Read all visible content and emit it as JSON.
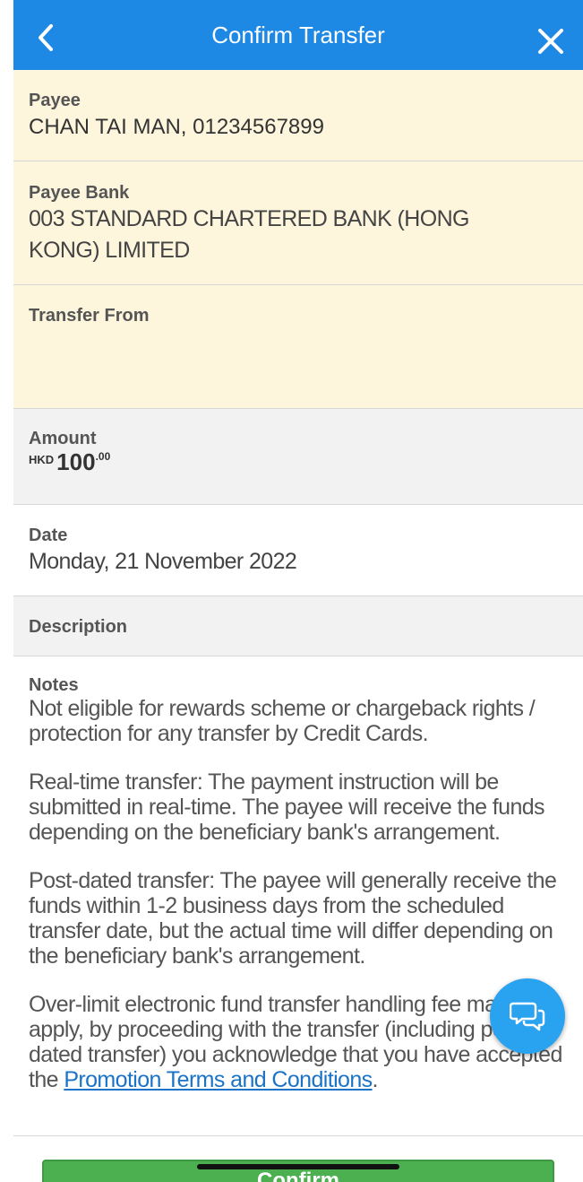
{
  "header": {
    "title": "Confirm Transfer"
  },
  "payee": {
    "label": "Payee",
    "value": "CHAN TAI MAN, 01234567899"
  },
  "payee_bank": {
    "label": "Payee Bank",
    "value": "003 STANDARD CHARTERED BANK (HONG KONG) LIMITED"
  },
  "transfer_from": {
    "label": "Transfer From"
  },
  "amount": {
    "label": "Amount",
    "currency": "HKD",
    "integer": "100",
    "decimal": ".00"
  },
  "date": {
    "label": "Date",
    "value": "Monday, 21 November 2022"
  },
  "description": {
    "label": "Description"
  },
  "notes": {
    "label": "Notes",
    "para1": "Not eligible for rewards scheme or chargeback rights / protection for any transfer by Credit Cards.",
    "para2": "Real-time transfer: The payment instruction will be submitted in real-time. The payee will receive the funds depending on the beneficiary bank's arrangement.",
    "para3": "Post-dated transfer: The payee will generally receive the funds within 1-2 business days from the scheduled transfer date, but the actual time will differ depending on the beneficiary bank's arrangement.",
    "para4_prefix": "Over-limit electronic fund transfer handling fee may apply, by proceeding with the transfer (including post-dated transfer) you acknowledge that you have accepted the ",
    "para4_link": "Promotion Terms and Conditions",
    "para4_suffix": "."
  },
  "footer": {
    "confirm_label": "Confirm"
  },
  "icons": {
    "back": "chevron-left-icon",
    "close": "close-icon",
    "chat": "chat-bubbles-icon"
  },
  "colors": {
    "header": "#1e88e5",
    "cream": "#fdf5dc",
    "grey": "#f2f2f2",
    "confirm": "#4caf50",
    "chat": "#29a3f0",
    "link": "#1a73c7"
  }
}
